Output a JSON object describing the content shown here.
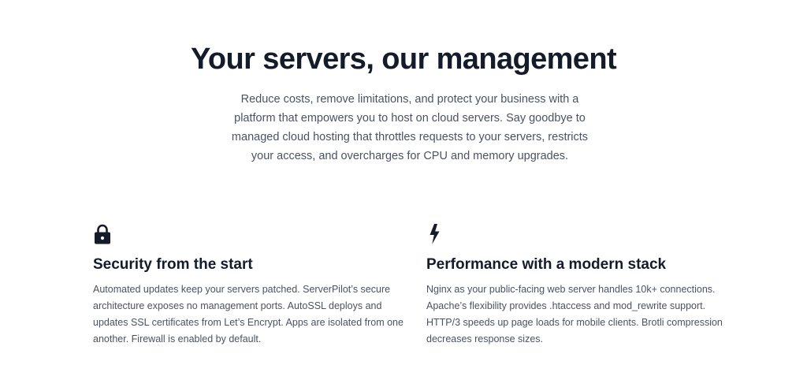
{
  "hero": {
    "title": "Your servers, our management",
    "subtitle": "Reduce costs, remove limitations, and protect your business with a platform that empowers you to host on cloud servers. Say goodbye to managed cloud hosting that throttles requests to your servers, restricts your access, and overcharges for CPU and memory upgrades."
  },
  "features": [
    {
      "icon": "lock-icon",
      "title": "Security from the start",
      "text": "Automated updates keep your servers patched. ServerPilot’s secure architecture exposes no management ports. AutoSSL deploys and updates SSL certificates from Let’s Encrypt. Apps are isolated from one another. Firewall is enabled by default."
    },
    {
      "icon": "lightning-bolt-icon",
      "title": "Performance with a modern stack",
      "text": "Nginx as your public-facing web server handles 10k+ connections. Apache’s flexibility provides .htaccess and mod_rewrite support. HTTP/3 speeds up page loads for mobile clients. Brotli compression decreases response sizes."
    }
  ],
  "colors": {
    "heading": "#141b2a",
    "body_text": "#4a5263",
    "background": "#ffffff"
  }
}
